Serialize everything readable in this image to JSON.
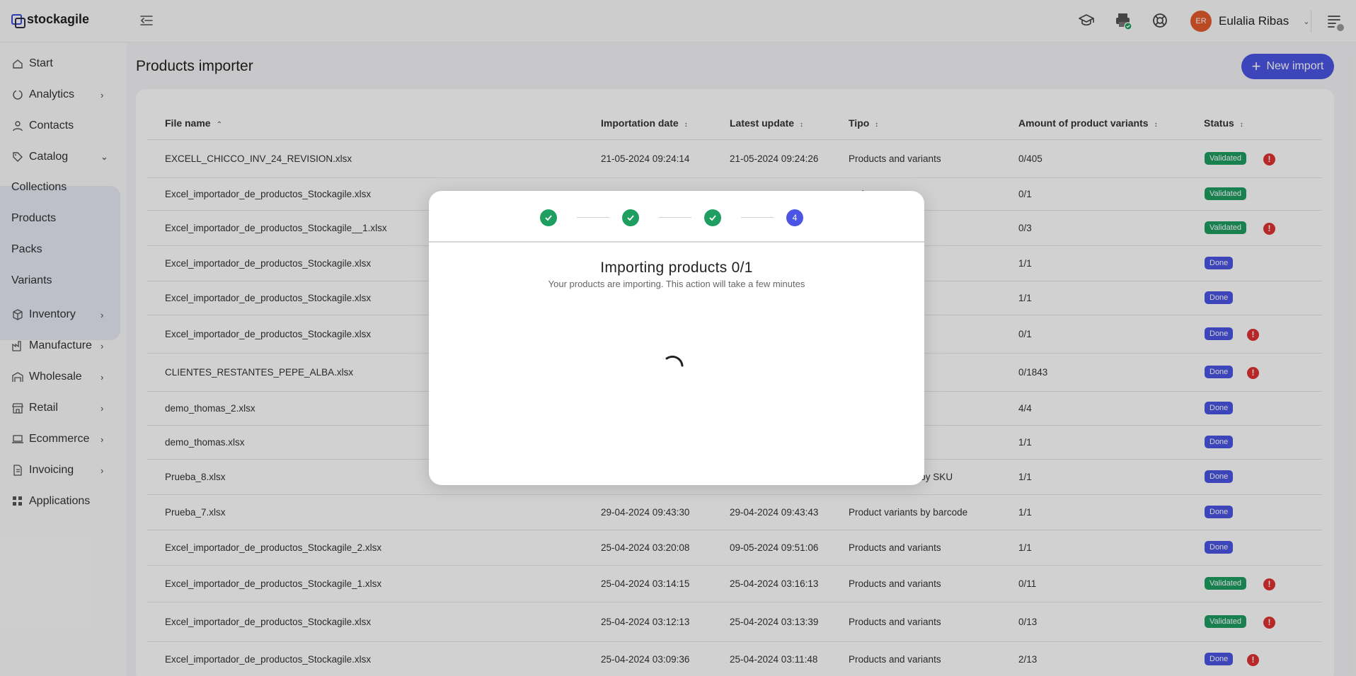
{
  "app": {
    "brand": "stockagile"
  },
  "user": {
    "initials": "ER",
    "name": "Eulalia Ribas"
  },
  "icons": {
    "collapse": "collapse-sidebar-icon",
    "academy": "graduation-cap-icon",
    "printer": "printer-icon",
    "help": "lifebuoy-icon",
    "menu": "list-menu-icon"
  },
  "sidebar": {
    "items": [
      {
        "label": "Start",
        "icon": "home-icon"
      },
      {
        "label": "Analytics",
        "icon": "analytics-icon",
        "expandable": true
      },
      {
        "label": "Contacts",
        "icon": "user-icon"
      },
      {
        "label": "Catalog",
        "icon": "tag-icon",
        "expandable": true,
        "expanded": true
      },
      {
        "label": "Inventory",
        "icon": "box-icon",
        "expandable": true
      },
      {
        "label": "Manufacture",
        "icon": "factory-icon",
        "expandable": true
      },
      {
        "label": "Wholesale",
        "icon": "wholesale-icon",
        "expandable": true
      },
      {
        "label": "Retail",
        "icon": "store-icon",
        "expandable": true
      },
      {
        "label": "Ecommerce",
        "icon": "laptop-icon",
        "expandable": true
      },
      {
        "label": "Invoicing",
        "icon": "invoice-icon",
        "expandable": true
      },
      {
        "label": "Applications",
        "icon": "apps-icon"
      }
    ],
    "catalog_sub": [
      "Collections",
      "Products",
      "Packs",
      "Variants"
    ]
  },
  "page": {
    "title": "Products importer",
    "new_import": "New import"
  },
  "table": {
    "columns": [
      "File name",
      "Importation date",
      "Latest update",
      "Tipo",
      "Amount of product variants",
      "Status"
    ],
    "rows": [
      {
        "file": "EXCELL_CHICCO_INV_24_REVISION.xlsx",
        "imported": "21-05-2024 09:24:14",
        "updated": "21-05-2024 09:24:26",
        "tipo": "Products and variants",
        "amount": "0/405",
        "status": "Validated",
        "warning": true
      },
      {
        "file": "Excel_importador_de_productos_Stockagile.xlsx",
        "imported": "",
        "updated": "",
        "tipo": "variants",
        "amount": "0/1",
        "status": "Validated",
        "warning": false
      },
      {
        "file": "Excel_importador_de_productos_Stockagile__1.xlsx",
        "imported": "",
        "updated": "",
        "tipo": "s by SKU",
        "amount": "0/3",
        "status": "Validated",
        "warning": true
      },
      {
        "file": "Excel_importador_de_productos_Stockagile.xlsx",
        "imported": "",
        "updated": "",
        "tipo": "ariants",
        "amount": "1/1",
        "status": "Done",
        "warning": false
      },
      {
        "file": "Excel_importador_de_productos_Stockagile.xlsx",
        "imported": "",
        "updated": "",
        "tipo": "ariants",
        "amount": "1/1",
        "status": "Done",
        "warning": false
      },
      {
        "file": "Excel_importador_de_productos_Stockagile.xlsx",
        "imported": "",
        "updated": "",
        "tipo": "ariants",
        "amount": "0/1",
        "status": "Done",
        "warning": true
      },
      {
        "file": "CLIENTES_RESTANTES_PEPE_ALBA.xlsx",
        "imported": "",
        "updated": "",
        "tipo": "s by barcode",
        "amount": "0/1843",
        "status": "Done",
        "warning": true
      },
      {
        "file": "demo_thomas_2.xlsx",
        "imported": "",
        "updated": "",
        "tipo": "duct variants",
        "amount": "4/4",
        "status": "Done",
        "warning": false
      },
      {
        "file": "demo_thomas.xlsx",
        "imported": "",
        "updated": "",
        "tipo": "duct variants",
        "amount": "1/1",
        "status": "Done",
        "warning": false
      },
      {
        "file": "Prueba_8.xlsx",
        "imported": "29-04-2024 09:45:44",
        "updated": "29-04-2024 09:46:00",
        "tipo": "Product variants by SKU",
        "amount": "1/1",
        "status": "Done",
        "warning": false
      },
      {
        "file": "Prueba_7.xlsx",
        "imported": "29-04-2024 09:43:30",
        "updated": "29-04-2024 09:43:43",
        "tipo": "Product variants by barcode",
        "amount": "1/1",
        "status": "Done",
        "warning": false
      },
      {
        "file": "Excel_importador_de_productos_Stockagile_2.xlsx",
        "imported": "25-04-2024 03:20:08",
        "updated": "09-05-2024 09:51:06",
        "tipo": "Products and variants",
        "amount": "1/1",
        "status": "Done",
        "warning": false
      },
      {
        "file": "Excel_importador_de_productos_Stockagile_1.xlsx",
        "imported": "25-04-2024 03:14:15",
        "updated": "25-04-2024 03:16:13",
        "tipo": "Products and variants",
        "amount": "0/11",
        "status": "Validated",
        "warning": true
      },
      {
        "file": "Excel_importador_de_productos_Stockagile.xlsx",
        "imported": "25-04-2024 03:12:13",
        "updated": "25-04-2024 03:13:39",
        "tipo": "Products and variants",
        "amount": "0/13",
        "status": "Validated",
        "warning": true
      },
      {
        "file": "Excel_importador_de_productos_Stockagile.xlsx",
        "imported": "25-04-2024 03:09:36",
        "updated": "25-04-2024 03:11:48",
        "tipo": "Products and variants",
        "amount": "2/13",
        "status": "Done",
        "warning": true
      }
    ]
  },
  "modal": {
    "steps": [
      "",
      "",
      "",
      "4"
    ],
    "title": "Importing products 0/1",
    "subtitle": "Your products are importing. This action will take a few minutes"
  },
  "colors": {
    "accent": "#4b55e3",
    "success": "#1e9e61",
    "danger": "#e03131",
    "avatar": "#e35b2d"
  }
}
